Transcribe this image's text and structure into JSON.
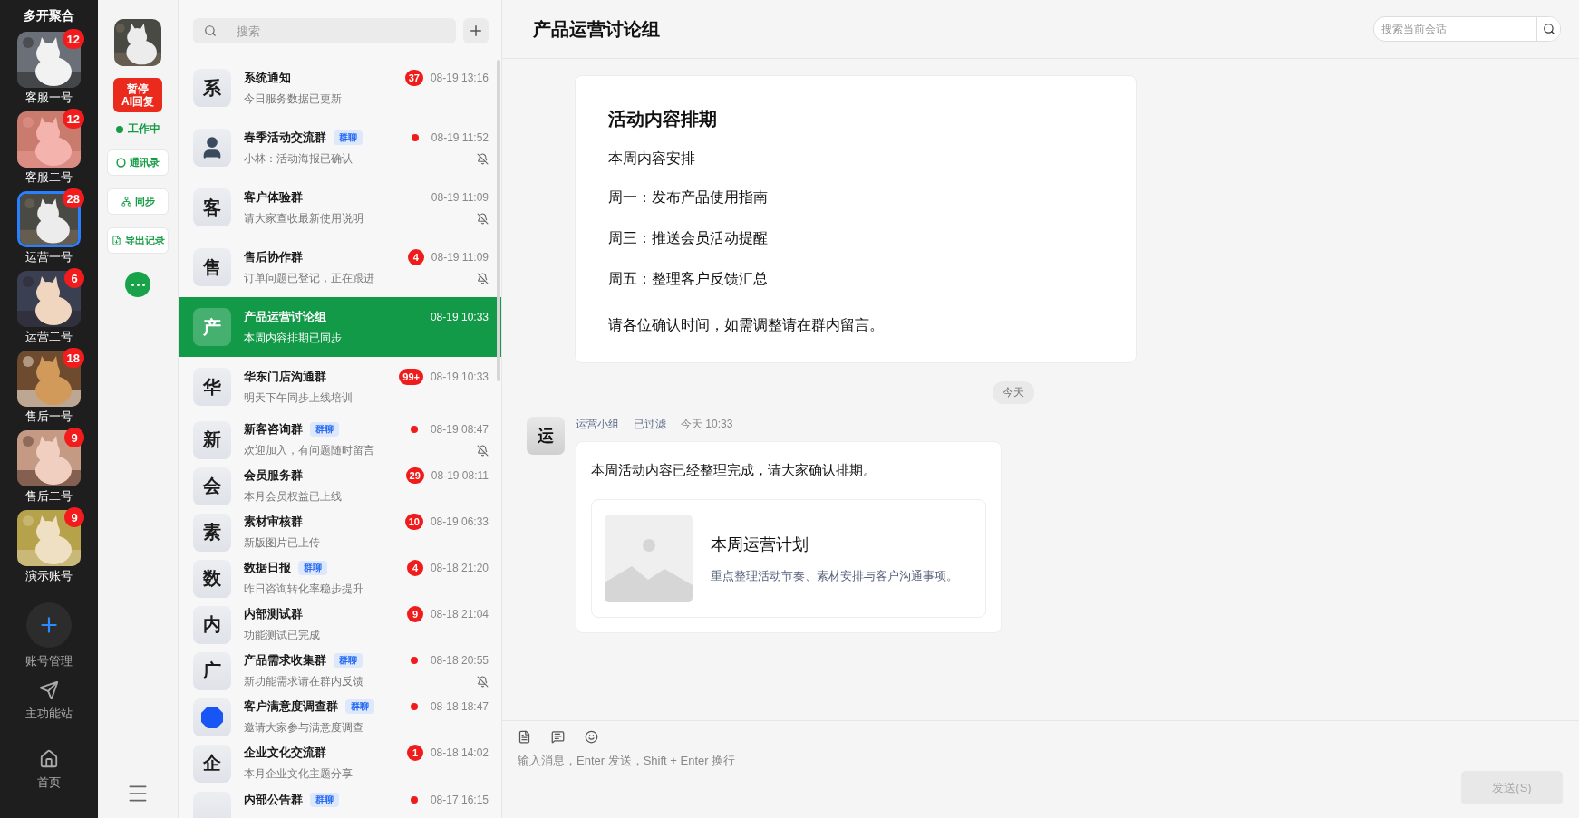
{
  "accounts_bar": {
    "title": "多开聚合",
    "accounts": [
      {
        "name": "客服一号",
        "badge": "12",
        "selected": false
      },
      {
        "name": "客服二号",
        "badge": "12",
        "selected": false
      },
      {
        "name": "运营一号",
        "badge": "28",
        "selected": true
      },
      {
        "name": "运营二号",
        "badge": "6",
        "selected": false
      },
      {
        "name": "售后一号",
        "badge": "18",
        "selected": false
      },
      {
        "name": "售后二号",
        "badge": "9",
        "selected": false
      },
      {
        "name": "演示账号",
        "badge": "9",
        "selected": false
      }
    ],
    "manage_label": "账号管理",
    "station_label": "主功能站",
    "home_label": "首页"
  },
  "tool_column": {
    "pause_button": {
      "line1": "暂停",
      "line2": "AI回复"
    },
    "status": "工作中",
    "actions": [
      {
        "kind": "contacts",
        "label": "通讯录"
      },
      {
        "kind": "sync",
        "label": "同步"
      },
      {
        "kind": "export",
        "label": "导出记录"
      }
    ]
  },
  "chat_list": {
    "search": {
      "placeholder": "搜索"
    },
    "chats": [
      {
        "kind": "letter",
        "avatar": "系",
        "name": "系统通知",
        "preview": "今日服务数据已更新",
        "time": "08-19 13:16",
        "badge": "37",
        "unread_dot": false,
        "muted": false,
        "selected": false
      },
      {
        "kind": "person",
        "name": "春季活动交流群",
        "tag": "群聊",
        "preview": "小林：活动海报已确认",
        "time": "08-19 11:52",
        "unread_dot": true,
        "muted": true,
        "selected": false
      },
      {
        "kind": "letter",
        "avatar": "客",
        "name": "客户体验群",
        "preview": "请大家查收最新使用说明",
        "time": "08-19 11:09",
        "unread_dot": false,
        "muted": true,
        "selected": false
      },
      {
        "kind": "letter",
        "avatar": "售",
        "name": "售后协作群",
        "preview": "订单问题已登记，正在跟进",
        "time": "08-19 11:09",
        "badge": "4",
        "unread_dot": false,
        "muted": true,
        "selected": false
      },
      {
        "kind": "letter",
        "avatar": "产",
        "name": "产品运营讨论组",
        "preview": "本周内容排期已同步",
        "time": "08-19 10:33",
        "unread_dot": false,
        "muted": false,
        "selected": true
      },
      {
        "kind": "letter",
        "avatar": "华",
        "name": "华东门店沟通群",
        "preview": "明天下午同步上线培训",
        "time": "08-19 10:33",
        "badge": "99+",
        "unread_dot": false,
        "muted": false,
        "selected": false
      },
      {
        "kind": "letter",
        "avatar": "新",
        "name": "新客咨询群",
        "tag": "群聊",
        "preview": "欢迎加入，有问题随时留言",
        "time": "08-19 08:47",
        "unread_dot": true,
        "muted": true,
        "selected": false
      },
      {
        "kind": "letter",
        "avatar": "会",
        "name": "会员服务群",
        "preview": "本月会员权益已上线",
        "time": "08-19 08:11",
        "badge": "29",
        "unread_dot": false,
        "muted": false,
        "selected": false
      },
      {
        "kind": "letter",
        "avatar": "素",
        "name": "素材审核群",
        "preview": "新版图片已上传",
        "time": "08-19 06:33",
        "badge": "10",
        "unread_dot": false,
        "muted": false,
        "selected": false
      },
      {
        "kind": "letter",
        "avatar": "数",
        "name": "数据日报",
        "tag": "群聊",
        "preview": "昨日咨询转化率稳步提升",
        "time": "08-18 21:20",
        "badge": "4",
        "unread_dot": false,
        "muted": false,
        "selected": false
      },
      {
        "kind": "letter",
        "avatar": "内",
        "name": "内部测试群",
        "preview": "功能测试已完成",
        "time": "08-18 21:04",
        "badge": "9",
        "unread_dot": false,
        "muted": false,
        "selected": false
      },
      {
        "kind": "letter",
        "avatar": "广",
        "name": "产品需求收集群",
        "tag": "群聊",
        "preview": "新功能需求请在群内反馈",
        "time": "08-18 20:55",
        "unread_dot": true,
        "muted": true,
        "selected": false
      },
      {
        "kind": "dot",
        "name": "客户满意度调查群",
        "tag": "群聊",
        "preview": "邀请大家参与满意度调查",
        "time": "08-18 18:47",
        "unread_dot": true,
        "muted": false,
        "selected": false
      },
      {
        "kind": "letter",
        "avatar": "企",
        "name": "企业文化交流群",
        "preview": "本月企业文化主题分享",
        "time": "08-18 14:02",
        "badge": "1",
        "unread_dot": false,
        "muted": false,
        "selected": false
      },
      {
        "kind": "letter",
        "name": "内部公告群",
        "tag": "群聊",
        "time": "08-17 16:15",
        "unread_dot": true,
        "muted": false,
        "selected": false
      }
    ]
  },
  "conversation": {
    "title": "产品运营讨论组",
    "search": {
      "placeholder": "搜索当前会话"
    },
    "pinned_card": {
      "title": "活动内容排期",
      "subtitle": "本周内容安排",
      "lines": [
        "周一：发布产品使用指南",
        "周三：推送会员活动提醒",
        "周五：整理客户反馈汇总"
      ],
      "note": "请各位确认时间，如需调整请在群内留言。"
    },
    "date_divider": "今天",
    "messages": [
      {
        "avatar": "运",
        "sender": "运营小组",
        "tag": "已过滤",
        "time": "今天 10:33",
        "text": "本周活动内容已经整理完成，请大家确认排期。",
        "link": {
          "title": "本周运营计划",
          "description": "重点整理活动节奏、素材安排与客户沟通事项。"
        }
      }
    ],
    "composer": {
      "placeholder": "输入消息，Enter 发送，Shift + Enter 换行",
      "send": "发送(S)",
      "send_disabled": true
    }
  }
}
